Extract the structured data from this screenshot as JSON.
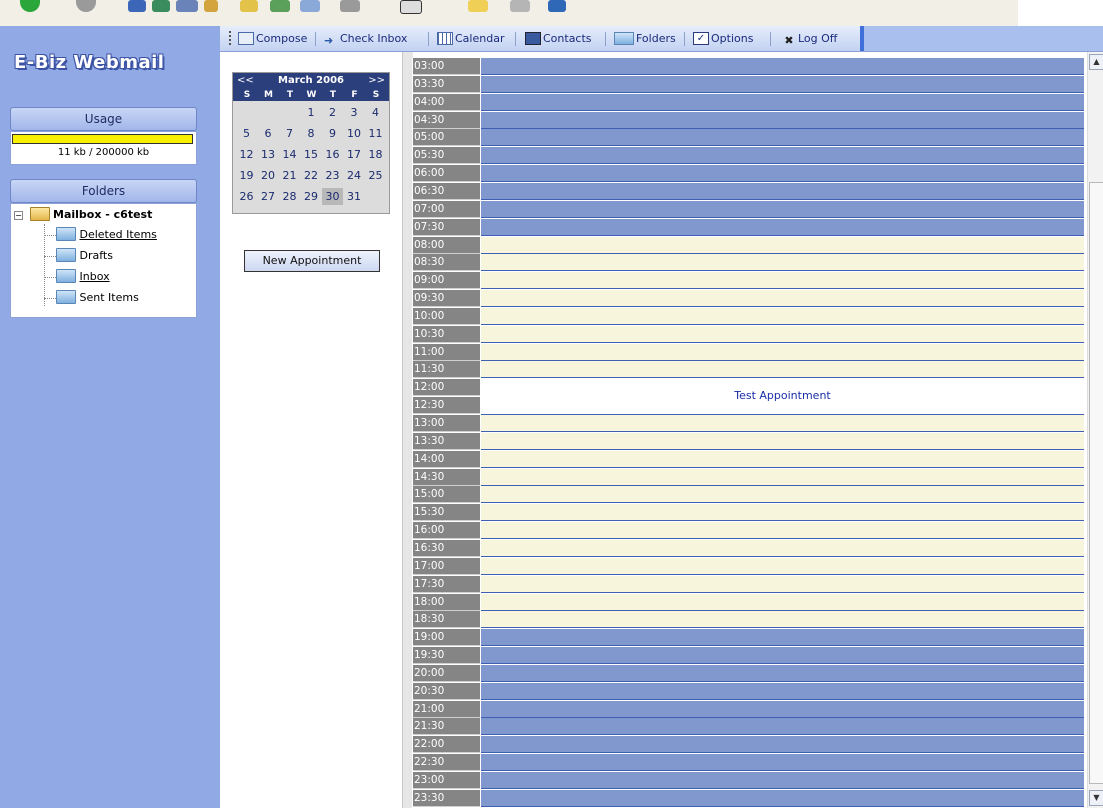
{
  "app": {
    "logo": "E-Biz Webmail"
  },
  "sidebar": {
    "usage_header": "Usage",
    "usage_text": "11 kb / 200000 kb",
    "usage_fill": 0.99,
    "folders_header": "Folders",
    "tree": {
      "root": "Mailbox - c6test",
      "items": [
        {
          "label": "Deleted Items",
          "underlined": true
        },
        {
          "label": "Drafts",
          "underlined": false
        },
        {
          "label": "Inbox",
          "underlined": true
        },
        {
          "label": "Sent Items",
          "underlined": false
        }
      ]
    }
  },
  "menu": {
    "compose": "Compose",
    "check_inbox": "Check Inbox",
    "calendar": "Calendar",
    "contacts": "Contacts",
    "folders": "Folders",
    "options": "Options",
    "log_off": "Log Off"
  },
  "minical": {
    "prev": "<<",
    "next": ">>",
    "month": "March 2006",
    "dow": [
      "S",
      "M",
      "T",
      "W",
      "T",
      "F",
      "S"
    ],
    "weeks": [
      [
        "",
        "",
        "",
        "1",
        "2",
        "3",
        "4"
      ],
      [
        "5",
        "6",
        "7",
        "8",
        "9",
        "10",
        "11"
      ],
      [
        "12",
        "13",
        "14",
        "15",
        "16",
        "17",
        "18"
      ],
      [
        "19",
        "20",
        "21",
        "22",
        "23",
        "24",
        "25"
      ],
      [
        "26",
        "27",
        "28",
        "29",
        "30",
        "31",
        ""
      ]
    ],
    "selected_day": "30"
  },
  "new_appointment_label": "New Appointment",
  "schedule": {
    "slots": [
      {
        "time": "03:00",
        "hours": "off"
      },
      {
        "time": "03:30",
        "hours": "off"
      },
      {
        "time": "04:00",
        "hours": "off"
      },
      {
        "time": "04:30",
        "hours": "off"
      },
      {
        "time": "05:00",
        "hours": "off"
      },
      {
        "time": "05:30",
        "hours": "off"
      },
      {
        "time": "06:00",
        "hours": "off"
      },
      {
        "time": "06:30",
        "hours": "off"
      },
      {
        "time": "07:00",
        "hours": "off"
      },
      {
        "time": "07:30",
        "hours": "off"
      },
      {
        "time": "08:00",
        "hours": "on"
      },
      {
        "time": "08:30",
        "hours": "on"
      },
      {
        "time": "09:00",
        "hours": "on"
      },
      {
        "time": "09:30",
        "hours": "on"
      },
      {
        "time": "10:00",
        "hours": "on"
      },
      {
        "time": "10:30",
        "hours": "on"
      },
      {
        "time": "11:00",
        "hours": "on"
      },
      {
        "time": "11:30",
        "hours": "on"
      },
      {
        "time": "12:00",
        "hours": "on"
      },
      {
        "time": "12:30",
        "hours": "on"
      },
      {
        "time": "13:00",
        "hours": "on"
      },
      {
        "time": "13:30",
        "hours": "on"
      },
      {
        "time": "14:00",
        "hours": "on"
      },
      {
        "time": "14:30",
        "hours": "on"
      },
      {
        "time": "15:00",
        "hours": "on"
      },
      {
        "time": "15:30",
        "hours": "on"
      },
      {
        "time": "16:00",
        "hours": "on"
      },
      {
        "time": "16:30",
        "hours": "on"
      },
      {
        "time": "17:00",
        "hours": "on"
      },
      {
        "time": "17:30",
        "hours": "on"
      },
      {
        "time": "18:00",
        "hours": "on"
      },
      {
        "time": "18:30",
        "hours": "on"
      },
      {
        "time": "19:00",
        "hours": "off"
      },
      {
        "time": "19:30",
        "hours": "off"
      },
      {
        "time": "20:00",
        "hours": "off"
      },
      {
        "time": "20:30",
        "hours": "off"
      },
      {
        "time": "21:00",
        "hours": "off"
      },
      {
        "time": "21:30",
        "hours": "off"
      },
      {
        "time": "22:00",
        "hours": "off"
      },
      {
        "time": "22:30",
        "hours": "off"
      },
      {
        "time": "23:00",
        "hours": "off"
      },
      {
        "time": "23:30",
        "hours": "off"
      }
    ],
    "appointment": {
      "title": "Test Appointment",
      "start": "12:00",
      "end": "13:00"
    }
  },
  "colors": {
    "sidebar_bg": "#91a9e4",
    "off_hours": "#8198cf",
    "work_hours": "#f7f6dd",
    "time_cell": "#858585",
    "usage_bar": "#f8f000"
  }
}
